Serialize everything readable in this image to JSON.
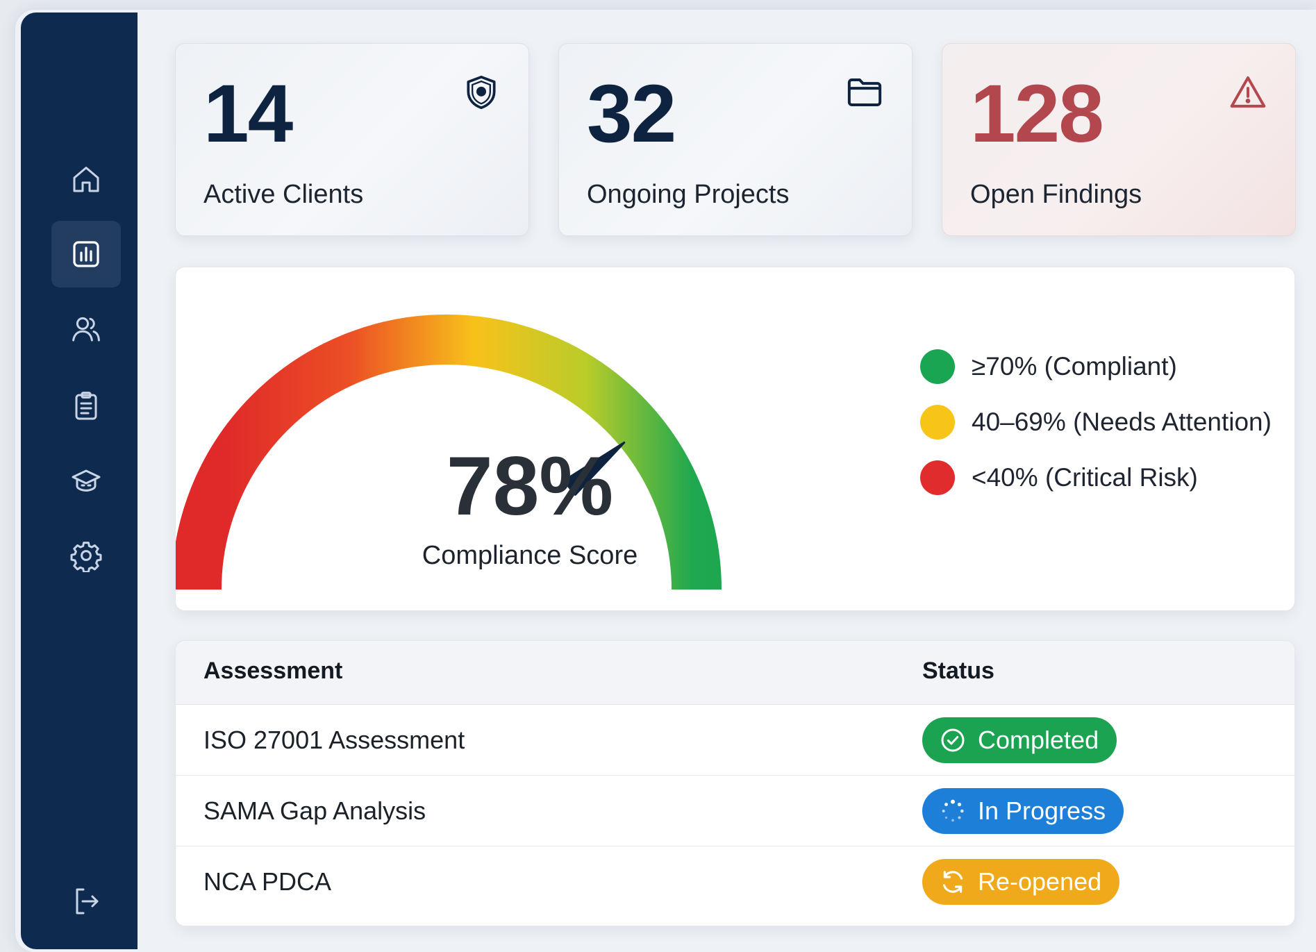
{
  "sidebar": {
    "items": [
      {
        "icon": "home-icon",
        "active": false
      },
      {
        "icon": "dashboard-chart-icon",
        "active": true
      },
      {
        "icon": "users-icon",
        "active": false
      },
      {
        "icon": "clipboard-icon",
        "active": false
      },
      {
        "icon": "training-cap-icon",
        "active": false
      },
      {
        "icon": "gear-icon",
        "active": false
      }
    ],
    "logout_icon": "logout-icon"
  },
  "stats": [
    {
      "value": "14",
      "label": "Active Clients",
      "icon": "shield-icon"
    },
    {
      "value": "32",
      "label": "Ongoing Projects",
      "icon": "folder-icon"
    },
    {
      "value": "128",
      "label": "Open Findings",
      "icon": "warning-icon",
      "color": "#b2474d"
    }
  ],
  "gauge": {
    "value": "78%",
    "percent": 78,
    "caption": "Compliance Score",
    "legend": [
      {
        "label": "≥70% (Compliant)",
        "color": "#1aa552"
      },
      {
        "label": "40–69% (Needs Attention)",
        "color": "#f7c518"
      },
      {
        "label": "<40% (Critical Risk)",
        "color": "#e02c2c"
      }
    ]
  },
  "table": {
    "headers": {
      "assessment": "Assessment",
      "status": "Status"
    },
    "rows": [
      {
        "name": "ISO 27001 Assessment",
        "status": "Completed",
        "status_icon": "check-circle-icon",
        "color": "#1ba351"
      },
      {
        "name": "SAMA Gap Analysis",
        "status": "In Progress",
        "status_icon": "spinner-icon",
        "color": "#1e7fd8"
      },
      {
        "name": "NCA PDCA",
        "status": "Re-opened",
        "status_icon": "refresh-icon",
        "color": "#f0a91a"
      }
    ]
  }
}
